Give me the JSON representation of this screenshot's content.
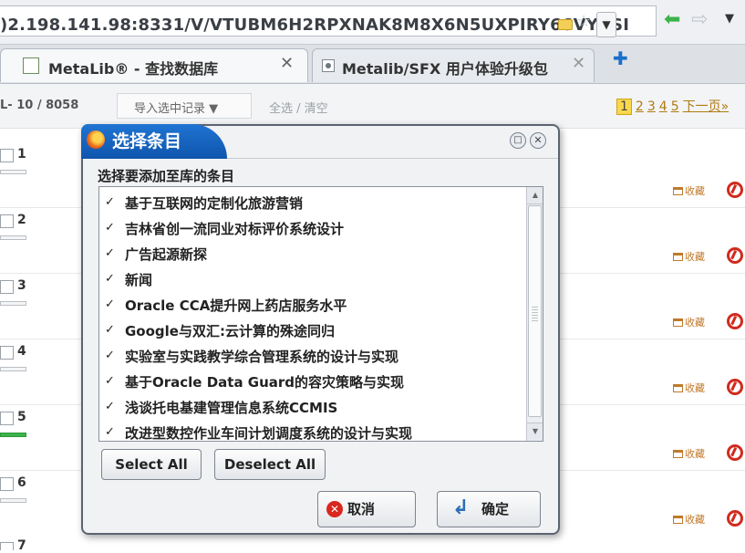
{
  "browser": {
    "url": ")2.198.141.98:8331/V/VTUBM6H2RPXNAK8M8X6N5UXPIRY66VYVSI",
    "url_dropdown_glyph": "▼",
    "star_glyph": "☆",
    "back_glyph": "⬅",
    "forward_glyph": "⇨",
    "menu_glyph": "▼",
    "tabs": [
      {
        "title": "MetaLib® - 查找数据库",
        "close": "✕"
      },
      {
        "title": "Metalib/SFX 用户体验升级包",
        "close": "✕"
      }
    ],
    "new_tab_glyph": "✚"
  },
  "toolbar": {
    "record_range": "L- 10 / 8058",
    "import_label": "导入选中记录 ▼",
    "select_clear": "全选 / 清空",
    "pager_current": "1",
    "pager_pages": [
      "2",
      "3",
      "4",
      "5"
    ],
    "pager_next": "下一页»"
  },
  "results": {
    "rows": [
      {
        "num": "1",
        "fav": "收藏"
      },
      {
        "num": "2",
        "fav": "收藏"
      },
      {
        "num": "3",
        "fav": "收藏"
      },
      {
        "num": "4",
        "fav": "收藏"
      },
      {
        "num": "5",
        "fav": "收藏"
      },
      {
        "num": "6",
        "fav": "收藏"
      }
    ],
    "row7_num": "7"
  },
  "dialog": {
    "title": "选择条目",
    "min_glyph": "□",
    "close_glyph": "✕",
    "prompt": "选择要添加至库的条目",
    "items": [
      {
        "checked": "✓",
        "label": "基于互联网的定制化旅游营销"
      },
      {
        "checked": "✓",
        "label": "吉林省创一流同业对标评价系统设计"
      },
      {
        "checked": "✓",
        "label": "广告起源新探"
      },
      {
        "checked": "✓",
        "label": "新闻"
      },
      {
        "checked": "✓",
        "label": "Oracle CCA提升网上药店服务水平"
      },
      {
        "checked": "✓",
        "label": "Google与双汇:云计算的殊途同归"
      },
      {
        "checked": "✓",
        "label": "实验室与实践教学综合管理系统的设计与实现"
      },
      {
        "checked": "✓",
        "label": "基于Oracle Data Guard的容灾策略与实现"
      },
      {
        "checked": "✓",
        "label": "浅谈托电基建管理信息系统CCMIS"
      },
      {
        "checked": "✓",
        "label": "改进型数控作业车间计划调度系统的设计与实现"
      }
    ],
    "scroll_up": "▲",
    "scroll_down": "▼",
    "select_all": "Select All",
    "deselect_all": "Deselect All",
    "cancel": "取消",
    "cancel_icon": "✕",
    "ok": "确定",
    "ok_icon": "↲"
  }
}
